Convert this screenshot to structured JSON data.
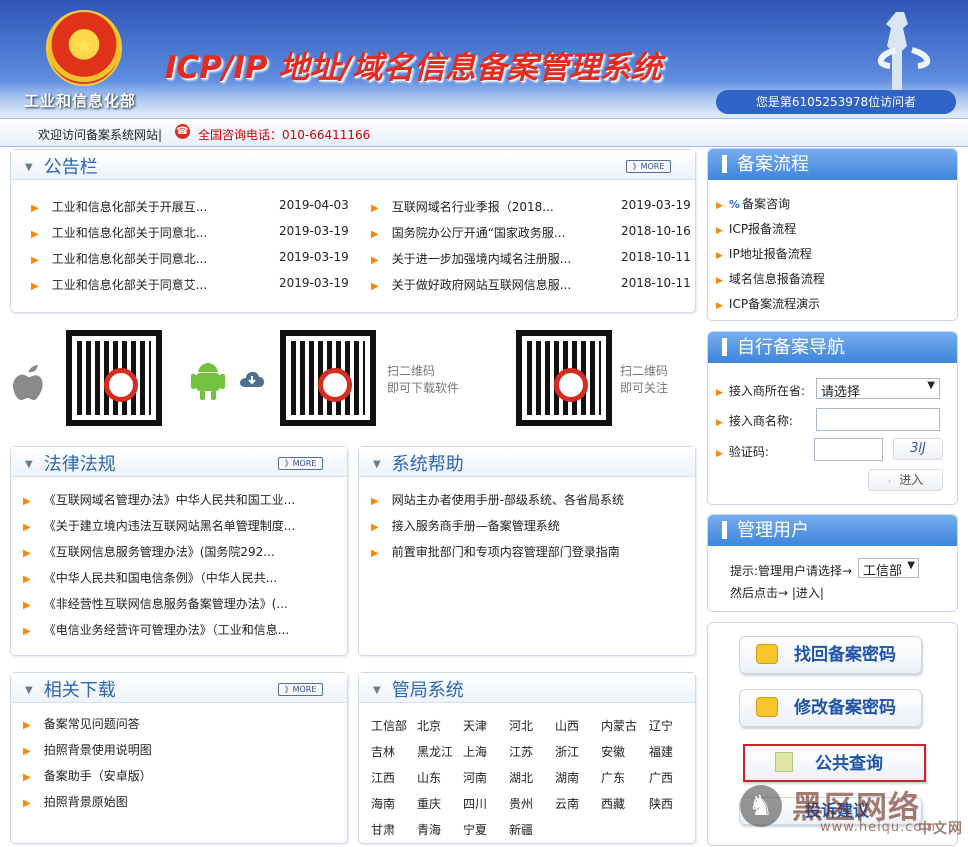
{
  "header": {
    "ministry": "工业和信息化部",
    "title": "ICP/IP 地址/域名信息备案管理系统",
    "visitor_text": "您是第6105253978位访问者"
  },
  "welcome": {
    "text": "欢迎访问备案系统网站|",
    "phone": "全国咨询电话：010-66411166"
  },
  "notice": {
    "title": "公告栏",
    "more": "》MORE",
    "items": [
      {
        "title": "工业和信息化部关于开展互...",
        "date": "2019-04-03"
      },
      {
        "title": "工业和信息化部关于同意北...",
        "date": "2019-03-19"
      },
      {
        "title": "工业和信息化部关于同意北...",
        "date": "2019-03-19"
      },
      {
        "title": "工业和信息化部关于同意艾...",
        "date": "2019-03-19"
      },
      {
        "title": "互联网域名行业季报（2018...",
        "date": "2019-03-19"
      },
      {
        "title": "国务院办公厅开通“国家政务服...",
        "date": "2018-10-16"
      },
      {
        "title": "关于进一步加强境内域名注册服...",
        "date": "2018-10-11"
      },
      {
        "title": "关于做好政府网站互联网信息服...",
        "date": "2018-10-11"
      }
    ]
  },
  "qr": {
    "software": "扫二维码\n即可下载软件",
    "follow": "扫二维码\n即可关注"
  },
  "law": {
    "title": "法律法规",
    "more": "》MORE",
    "items": [
      "《互联网域名管理办法》中华人民共和国工业...",
      "《关于建立境内违法互联网站黑名单管理制度...",
      "《互联网信息服务管理办法》(国务院292...",
      "《中华人民共和国电信条例》（中华人民共...",
      "《非经营性互联网信息服务备案管理办法》(...",
      "《电信业务经营许可管理办法》（工业和信息..."
    ]
  },
  "help": {
    "title": "系统帮助",
    "items": [
      "网站主办者使用手册-部级系统、各省局系统",
      "接入服务商手册—备案管理系统",
      "前置审批部门和专项内容管理部门登录指南"
    ]
  },
  "downloads": {
    "title": "相关下载",
    "more": "》MORE",
    "items": [
      "备案常见问题问答",
      "拍照背景使用说明图",
      "备案助手（安卓版）",
      "拍照背景原始图"
    ]
  },
  "bureau": {
    "title": "管局系统",
    "cities": [
      "工信部",
      "北京",
      "天津",
      "河北",
      "山西",
      "内蒙古",
      "辽宁",
      "吉林",
      "黑龙江",
      "上海",
      "江苏",
      "浙江",
      "安徽",
      "福建",
      "江西",
      "山东",
      "河南",
      "湖北",
      "湖南",
      "广东",
      "广西",
      "海南",
      "重庆",
      "四川",
      "贵州",
      "云南",
      "西藏",
      "陕西",
      "甘肃",
      "青海",
      "宁夏",
      "新疆"
    ]
  },
  "process": {
    "title": "备案流程",
    "items": [
      "备案咨询",
      "ICP报备流程",
      "IP地址报备流程",
      "域名信息报备流程",
      "ICP备案流程演示"
    ]
  },
  "nav": {
    "title": "自行备案导航",
    "location_label": "接入商所在省:",
    "location_value": "请选择",
    "name_label": "接入商名称:",
    "captcha_label": "验证码:",
    "captcha_text": "3lJ",
    "enter": "进入"
  },
  "manage": {
    "title": "管理用户",
    "hint": "提示:管理用户请选择→",
    "select": "工信部",
    "after": "然后点击→ |进入|"
  },
  "actions": {
    "recover": "找回备案密码",
    "modify": "修改备案密码",
    "query": "公共查询",
    "suggest": "投诉建议"
  },
  "watermark": {
    "name": "黑区网络",
    "site": "www.heiqu.com"
  }
}
